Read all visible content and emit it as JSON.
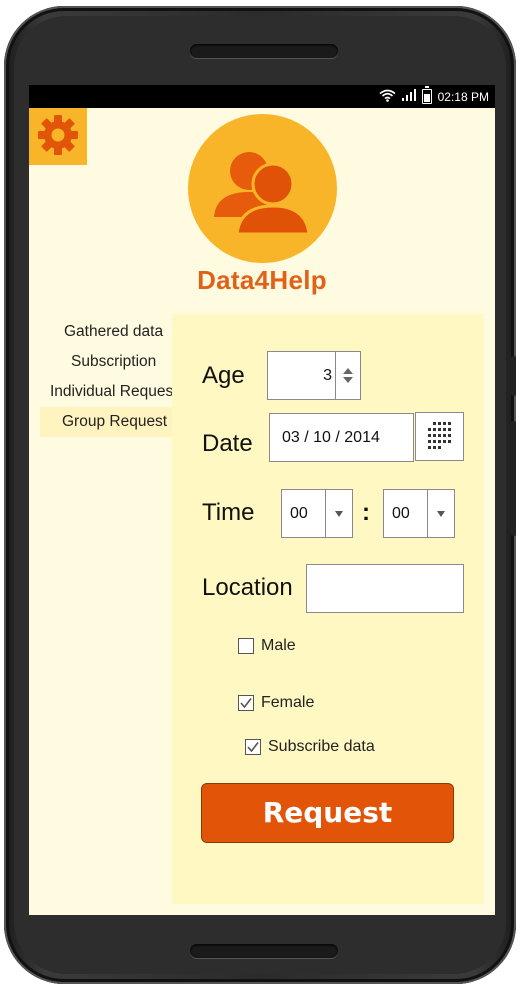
{
  "statusbar": {
    "time": "02:18 PM",
    "icons": [
      "wifi-icon",
      "signal-icon",
      "battery-icon"
    ]
  },
  "header": {
    "settings_icon": "gear-icon",
    "logo_icon": "users-group-icon",
    "app_title": "Data4Help"
  },
  "sidebar": {
    "items": [
      {
        "label": "Gathered data",
        "active": false
      },
      {
        "label": "Subscription",
        "active": false
      },
      {
        "label": "Individual Request",
        "active": false
      },
      {
        "label": "Group Request",
        "active": true
      }
    ]
  },
  "form": {
    "age_label": "Age",
    "age_value": "3",
    "date_label": "Date",
    "date_value": "03 / 10 / 2014",
    "time_label": "Time",
    "hour_value": "00",
    "time_separator": ":",
    "minute_value": "00",
    "location_label": "Location",
    "location_value": "",
    "male_label": "Male",
    "male_checked": false,
    "female_label": "Female",
    "female_checked": true,
    "subscribe_label": "Subscribe data",
    "subscribe_checked": true,
    "request_label": "Request"
  },
  "colors": {
    "accent_orange": "#f9b52a",
    "title_orange": "#e0621a",
    "button_orange": "#e25509",
    "screen_bg": "#fffbe0",
    "panel_bg": "#fff8c2"
  }
}
